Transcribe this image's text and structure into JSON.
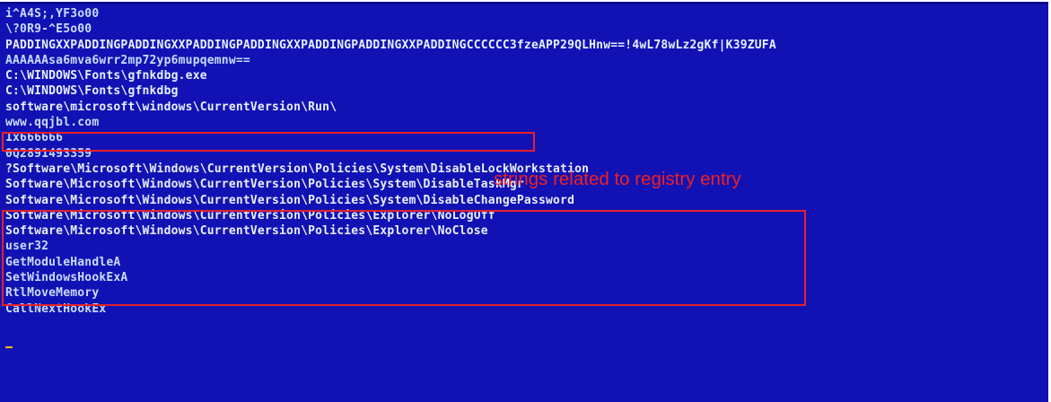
{
  "console": {
    "lines": [
      "i^A4S;,YF3o00",
      "\\?0R9-^E5o00",
      "PADDINGXXPADDINGPADDINGXXPADDINGPADDINGXXPADDINGPADDINGXXPADDINGCCCCCC3fzeAPP29QLHnw==!4wL78wLz2gKf|K39ZUFA",
      "AAAAAAsa6mva6wrr2mp72yp6mupqemnw==",
      "C:\\WINDOWS\\Fonts\\gfnkdbg.exe",
      "C:\\WINDOWS\\Fonts\\gfnkdbg",
      "software\\microsoft\\windows\\CurrentVersion\\Run\\",
      "www.qqjbl.com",
      "1x666666",
      "0Q2891493359",
      "?Software\\Microsoft\\Windows\\CurrentVersion\\Policies\\System\\DisableLockWorkstation",
      "Software\\Microsoft\\Windows\\CurrentVersion\\Policies\\System\\DisableTaskMgr",
      "Software\\Microsoft\\Windows\\CurrentVersion\\Policies\\System\\DisableChangePassword",
      "Software\\Microsoft\\Windows\\CurrentVersion\\Policies\\Explorer\\NoLogOff",
      "Software\\Microsoft\\Windows\\CurrentVersion\\Policies\\Explorer\\NoClose",
      "user32",
      "GetModuleHandleA",
      "SetWindowsHookExA",
      "RtlMoveMemory",
      "CallNextHookEx"
    ]
  },
  "annotation": {
    "text": "strings related to registry entry"
  },
  "colors": {
    "background": "#1212b4",
    "text": "#c8dcff",
    "highlight_box": "#e8202a",
    "annotation": "#f02020",
    "cursor": "#e8c000"
  }
}
